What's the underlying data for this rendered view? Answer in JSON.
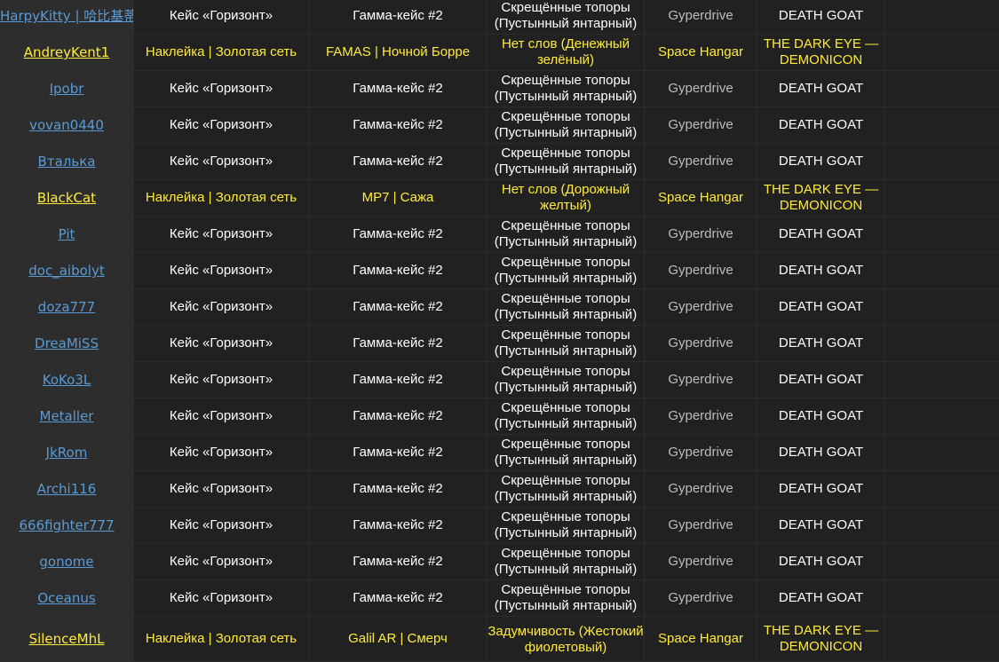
{
  "rows": [
    {
      "name": "HarpyKitty | 哈比基蒂",
      "case": "Кейс «Горизонт»",
      "gamma": "Гамма-кейс #2",
      "item": "Скрещённые топоры (Пустынный янтарный)",
      "ship": "Gyperdrive",
      "goat": "DEATH GOAT",
      "gold": false
    },
    {
      "name": "AndreyKent1",
      "case": "Наклейка | Золотая сеть",
      "gamma": "FAMAS | Ночной Борре",
      "item": "Нет слов (Денежный зелёный)",
      "ship": "Space Hangar",
      "goat": "THE DARK EYE — DEMONICON",
      "gold": true
    },
    {
      "name": "Ipobr",
      "case": "Кейс «Горизонт»",
      "gamma": "Гамма-кейс #2",
      "item": "Скрещённые топоры (Пустынный янтарный)",
      "ship": "Gyperdrive",
      "goat": "DEATH GOAT",
      "gold": false
    },
    {
      "name": "vovan0440",
      "case": "Кейс «Горизонт»",
      "gamma": "Гамма-кейс #2",
      "item": "Скрещённые топоры (Пустынный янтарный)",
      "ship": "Gyperdrive",
      "goat": "DEATH GOAT",
      "gold": false
    },
    {
      "name": "Вталька",
      "case": "Кейс «Горизонт»",
      "gamma": "Гамма-кейс #2",
      "item": "Скрещённые топоры (Пустынный янтарный)",
      "ship": "Gyperdrive",
      "goat": "DEATH GOAT",
      "gold": false
    },
    {
      "name": "BlackCat",
      "case": "Наклейка | Золотая сеть",
      "gamma": "MP7 | Сажа",
      "item": "Нет слов (Дорожный желтый)",
      "ship": "Space Hangar",
      "goat": "THE DARK EYE — DEMONICON",
      "gold": true
    },
    {
      "name": "Pit",
      "case": "Кейс «Горизонт»",
      "gamma": "Гамма-кейс #2",
      "item": "Скрещённые топоры (Пустынный янтарный)",
      "ship": "Gyperdrive",
      "goat": "DEATH GOAT",
      "gold": false
    },
    {
      "name": "doc_aibolyt",
      "case": "Кейс «Горизонт»",
      "gamma": "Гамма-кейс #2",
      "item": "Скрещённые топоры (Пустынный янтарный)",
      "ship": "Gyperdrive",
      "goat": "DEATH GOAT",
      "gold": false
    },
    {
      "name": "doza777",
      "case": "Кейс «Горизонт»",
      "gamma": "Гамма-кейс #2",
      "item": "Скрещённые топоры (Пустынный янтарный)",
      "ship": "Gyperdrive",
      "goat": "DEATH GOAT",
      "gold": false
    },
    {
      "name": "DreaMiSS",
      "case": "Кейс «Горизонт»",
      "gamma": "Гамма-кейс #2",
      "item": "Скрещённые топоры (Пустынный янтарный)",
      "ship": "Gyperdrive",
      "goat": "DEATH GOAT",
      "gold": false
    },
    {
      "name": "KoKo3L",
      "case": "Кейс «Горизонт»",
      "gamma": "Гамма-кейс #2",
      "item": "Скрещённые топоры (Пустынный янтарный)",
      "ship": "Gyperdrive",
      "goat": "DEATH GOAT",
      "gold": false
    },
    {
      "name": "Metaller",
      "case": "Кейс «Горизонт»",
      "gamma": "Гамма-кейс #2",
      "item": "Скрещённые топоры (Пустынный янтарный)",
      "ship": "Gyperdrive",
      "goat": "DEATH GOAT",
      "gold": false
    },
    {
      "name": "JkRom",
      "case": "Кейс «Горизонт»",
      "gamma": "Гамма-кейс #2",
      "item": "Скрещённые топоры (Пустынный янтарный)",
      "ship": "Gyperdrive",
      "goat": "DEATH GOAT",
      "gold": false
    },
    {
      "name": "Archi116",
      "case": "Кейс «Горизонт»",
      "gamma": "Гамма-кейс #2",
      "item": "Скрещённые топоры (Пустынный янтарный)",
      "ship": "Gyperdrive",
      "goat": "DEATH GOAT",
      "gold": false
    },
    {
      "name": "666fighter777",
      "case": "Кейс «Горизонт»",
      "gamma": "Гамма-кейс #2",
      "item": "Скрещённые топоры (Пустынный янтарный)",
      "ship": "Gyperdrive",
      "goat": "DEATH GOAT",
      "gold": false
    },
    {
      "name": "gonome",
      "case": "Кейс «Горизонт»",
      "gamma": "Гамма-кейс #2",
      "item": "Скрещённые топоры (Пустынный янтарный)",
      "ship": "Gyperdrive",
      "goat": "DEATH GOAT",
      "gold": false
    },
    {
      "name": "Oceanus",
      "case": "Кейс «Горизонт»",
      "gamma": "Гамма-кейс #2",
      "item": "Скрещённые топоры (Пустынный янтарный)",
      "ship": "Gyperdrive",
      "goat": "DEATH GOAT",
      "gold": false
    },
    {
      "name": "SilenceMhL",
      "case": "Наклейка | Золотая сеть",
      "gamma": "Galil AR | Смерч",
      "item": "Задумчивость (Жестокий фиолетовый)",
      "ship": "Space Hangar",
      "goat": "THE DARK EYE — DEMONICON",
      "gold": true
    }
  ],
  "colors": {
    "background": "#212121",
    "name_column": "#2d2d2d",
    "link_blue": "#5a9bd5",
    "highlight_yellow": "#ffeb3b",
    "muted_text": "#bdbdbd"
  }
}
